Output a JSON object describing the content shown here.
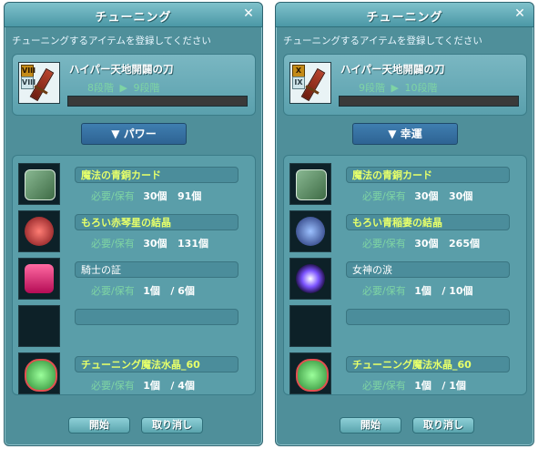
{
  "window1": {
    "title": "チューニング",
    "instruction": "チューニングするアイテムを登録してください",
    "item_name": "ハイパー天地開闢の刀",
    "item_badge_top": "VIII",
    "item_badge_bottom": "VIII",
    "stage_from": "8段階",
    "stage_to": "9段階",
    "progress_fraction": 0.0,
    "mode_label": "▼ パワー",
    "materials": [
      {
        "name": "魔法の青銅カード",
        "req_label": "必要/保有",
        "req": "30個",
        "have": "91個",
        "name_style": "yellow",
        "icon": "card-icon"
      },
      {
        "name": "もろい赤琴星の結晶",
        "req_label": "必要/保有",
        "req": "30個",
        "have": "131個",
        "name_style": "yellow",
        "icon": "red-crystal-icon"
      },
      {
        "name": "騎士の証",
        "req_label": "必要/保有",
        "req": "1個",
        "have": "/ 6個",
        "name_style": "white",
        "icon": "knight-emblem-icon"
      },
      {
        "name": "",
        "req_label": "",
        "req": "",
        "have": "",
        "name_style": "white",
        "icon": "empty-slot-icon"
      },
      {
        "name": "チューニング魔法水晶_60",
        "req_label": "必要/保有",
        "req": "1個",
        "have": "/ 4個",
        "name_style": "yellow",
        "icon": "magic-crystal-icon"
      }
    ],
    "start_label": "開始",
    "cancel_label": "取り消し"
  },
  "window2": {
    "title": "チューニング",
    "instruction": "チューニングするアイテムを登録してください",
    "item_name": "ハイパー天地開闢の刀",
    "item_badge_top": "X",
    "item_badge_bottom": "IX",
    "stage_from": "9段階",
    "stage_to": "10段階",
    "progress_fraction": 0.0,
    "mode_label": "▼ 幸運",
    "materials": [
      {
        "name": "魔法の青銅カード",
        "req_label": "必要/保有",
        "req": "30個",
        "have": "30個",
        "name_style": "yellow",
        "icon": "card-icon"
      },
      {
        "name": "もろい青稲妻の結晶",
        "req_label": "必要/保有",
        "req": "30個",
        "have": "265個",
        "name_style": "yellow",
        "icon": "blue-crystal-icon"
      },
      {
        "name": "女神の涙",
        "req_label": "必要/保有",
        "req": "1個",
        "have": "/ 10個",
        "name_style": "white",
        "icon": "goddess-tear-icon"
      },
      {
        "name": "",
        "req_label": "",
        "req": "",
        "have": "",
        "name_style": "white",
        "icon": "empty-slot-icon"
      },
      {
        "name": "チューニング魔法水晶_60",
        "req_label": "必要/保有",
        "req": "1個",
        "have": "/ 1個",
        "name_style": "yellow",
        "icon": "magic-crystal-icon"
      }
    ],
    "start_label": "開始",
    "cancel_label": "取り消し"
  }
}
